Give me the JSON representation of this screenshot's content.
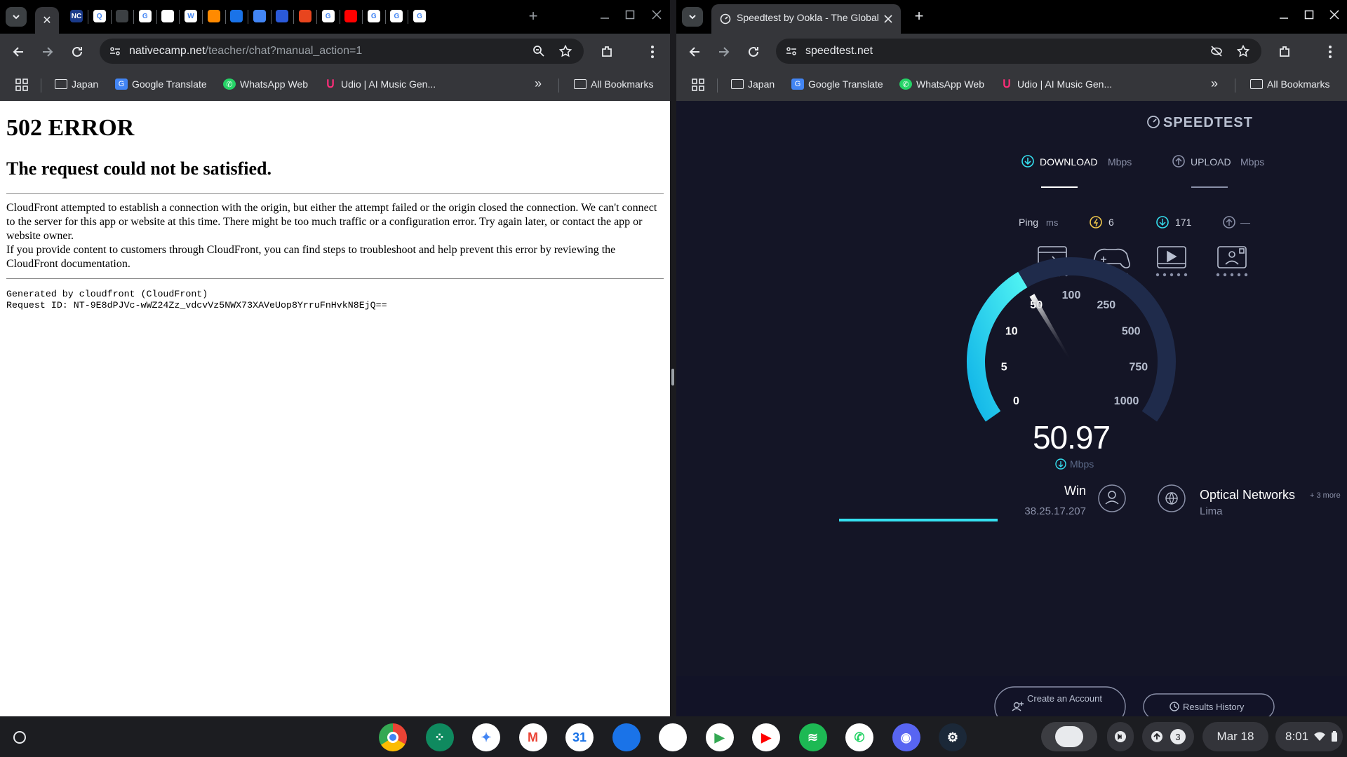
{
  "left_window": {
    "tab_close_icon": "✕",
    "favicons": [
      {
        "name": "nativecamp",
        "text": "NC",
        "color": "#1a3a8a"
      },
      {
        "name": "q-app",
        "text": "Q",
        "color": "#fff"
      },
      {
        "name": "waveform",
        "text": "",
        "color": "#3c4043"
      },
      {
        "name": "google-1",
        "text": "G",
        "color": "#fff"
      },
      {
        "name": "chatgpt",
        "text": "",
        "color": "#fff"
      },
      {
        "name": "wikipedia",
        "text": "W",
        "color": "#fff"
      },
      {
        "name": "stack",
        "text": "",
        "color": "#ff8a00"
      },
      {
        "name": "blue-doc",
        "text": "",
        "color": "#1a73e8"
      },
      {
        "name": "cube",
        "text": "",
        "color": "#4285f4"
      },
      {
        "name": "planet",
        "text": "",
        "color": "#2b5ad9"
      },
      {
        "name": "ramen",
        "text": "",
        "color": "#e8451e"
      },
      {
        "name": "google-2",
        "text": "G",
        "color": "#fff"
      },
      {
        "name": "youtube",
        "text": "",
        "color": "#ff0000"
      },
      {
        "name": "google-3",
        "text": "G",
        "color": "#fff"
      },
      {
        "name": "google-4",
        "text": "G",
        "color": "#fff"
      },
      {
        "name": "google-5",
        "text": "G",
        "color": "#fff"
      }
    ],
    "new_tab": "+",
    "url_host": "nativecamp.net",
    "url_path": "/teacher/chat?manual_action=1",
    "bookmarks": [
      "Japan",
      "Google Translate",
      "WhatsApp Web",
      "Udio | AI Music Gen..."
    ],
    "more_bookmarks": "»",
    "all_bookmarks": "All Bookmarks",
    "page": {
      "heading": "502 ERROR",
      "subheading": "The request could not be satisfied.",
      "para1": "CloudFront attempted to establish a connection with the origin, but either the attempt failed or the origin closed the connection. We can't connect to the server for this app or website at this time. There might be too much traffic or a configuration error. Try again later, or contact the app or website owner.",
      "para2": "If you provide content to customers through CloudFront, you can find steps to troubleshoot and help prevent this error by reviewing the CloudFront documentation.",
      "generated": "Generated by cloudfront (CloudFront)",
      "request_id": "Request ID: NT-9E8dPJVc-wWZ24Zz_vdcvVz5NWX73XAVeUop8YrruFnHvkN8EjQ=="
    }
  },
  "right_window": {
    "tab_title": "Speedtest by Ookla - The Global",
    "new_tab": "+",
    "url": "speedtest.net",
    "bookmarks": [
      "Japan",
      "Google Translate",
      "WhatsApp Web",
      "Udio | AI Music Gen..."
    ],
    "more_bookmarks": "»",
    "all_bookmarks": "All Bookmarks",
    "speedtest": {
      "logo": "SPEEDTEST",
      "download_label": "DOWNLOAD",
      "upload_label": "UPLOAD",
      "unit": "Mbps",
      "ping_label": "Ping",
      "ping_unit": "ms",
      "ping_idle": "6",
      "ping_download": "171",
      "ping_upload": "—",
      "gauge_ticks": [
        "0",
        "5",
        "10",
        "50",
        "100",
        "250",
        "500",
        "750",
        "1000"
      ],
      "gauge_value": 50.97,
      "speed_text": "50.97",
      "speed_unit": "Mbps",
      "provider": "Win",
      "ip": "38.25.17.207",
      "server": "Optical Networks",
      "server_more": "+ 3 more",
      "server_location": "Lima",
      "progress": 1.0,
      "create_account": "Create an Account",
      "results_history": "Results History"
    }
  },
  "taskbar": {
    "apps": [
      {
        "name": "chrome",
        "color": "#fff"
      },
      {
        "name": "launcher-apps",
        "color": "#0f8a5f"
      },
      {
        "name": "gemini",
        "color": "#fff"
      },
      {
        "name": "gmail",
        "color": "#fff"
      },
      {
        "name": "calendar",
        "color": "#fff"
      },
      {
        "name": "files",
        "color": "#1a73e8"
      },
      {
        "name": "messages",
        "color": "#fff"
      },
      {
        "name": "play-store",
        "color": "#fff"
      },
      {
        "name": "youtube",
        "color": "#fff"
      },
      {
        "name": "spotify",
        "color": "#1db954"
      },
      {
        "name": "whatsapp",
        "color": "#fff"
      },
      {
        "name": "discord",
        "color": "#5865f2"
      },
      {
        "name": "steam",
        "color": "#1b2838"
      }
    ],
    "calendar_day": "31",
    "notification_count": "3",
    "date": "Mar 18",
    "time": "8:01"
  },
  "colors": {
    "accent_cyan": "#35e0f0",
    "gauge_track": "#1f2b4b",
    "speedtest_bg": "#141526",
    "chrome_toolbar": "#35363a"
  }
}
